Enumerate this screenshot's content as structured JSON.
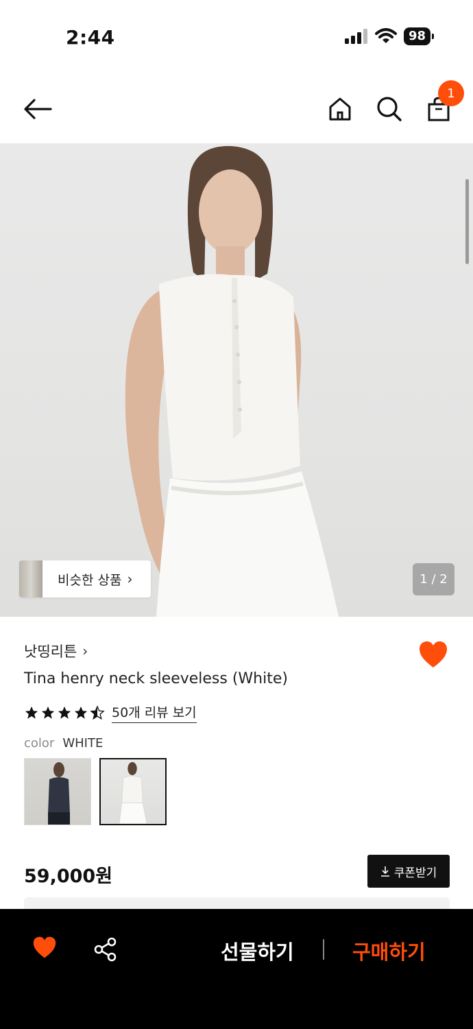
{
  "status_bar": {
    "time": "2:44",
    "battery": "98"
  },
  "nav": {
    "cart_count": "1",
    "icons": [
      "back-arrow-icon",
      "home-icon",
      "search-icon",
      "shopping-bag-icon"
    ]
  },
  "gallery": {
    "similar_label": "비슷한 상품",
    "similar_chevron": "›",
    "page_counter": "1 / 2"
  },
  "product": {
    "brand": "낫띵리튼",
    "brand_chevron": "›",
    "title": "Tina henry neck sleeveless (White)",
    "rating": 4.5,
    "review_link": "50개 리뷰 보기",
    "color_label": "color",
    "color_value": "WHITE",
    "swatches": [
      "navy",
      "white"
    ],
    "price": "59,000원",
    "coupon_label": "쿠폰받기"
  },
  "bottom_bar": {
    "gift_label": "선물하기",
    "buy_label": "구매하기"
  },
  "colors": {
    "accent": "#ff4d0a",
    "bar": "#000000"
  }
}
